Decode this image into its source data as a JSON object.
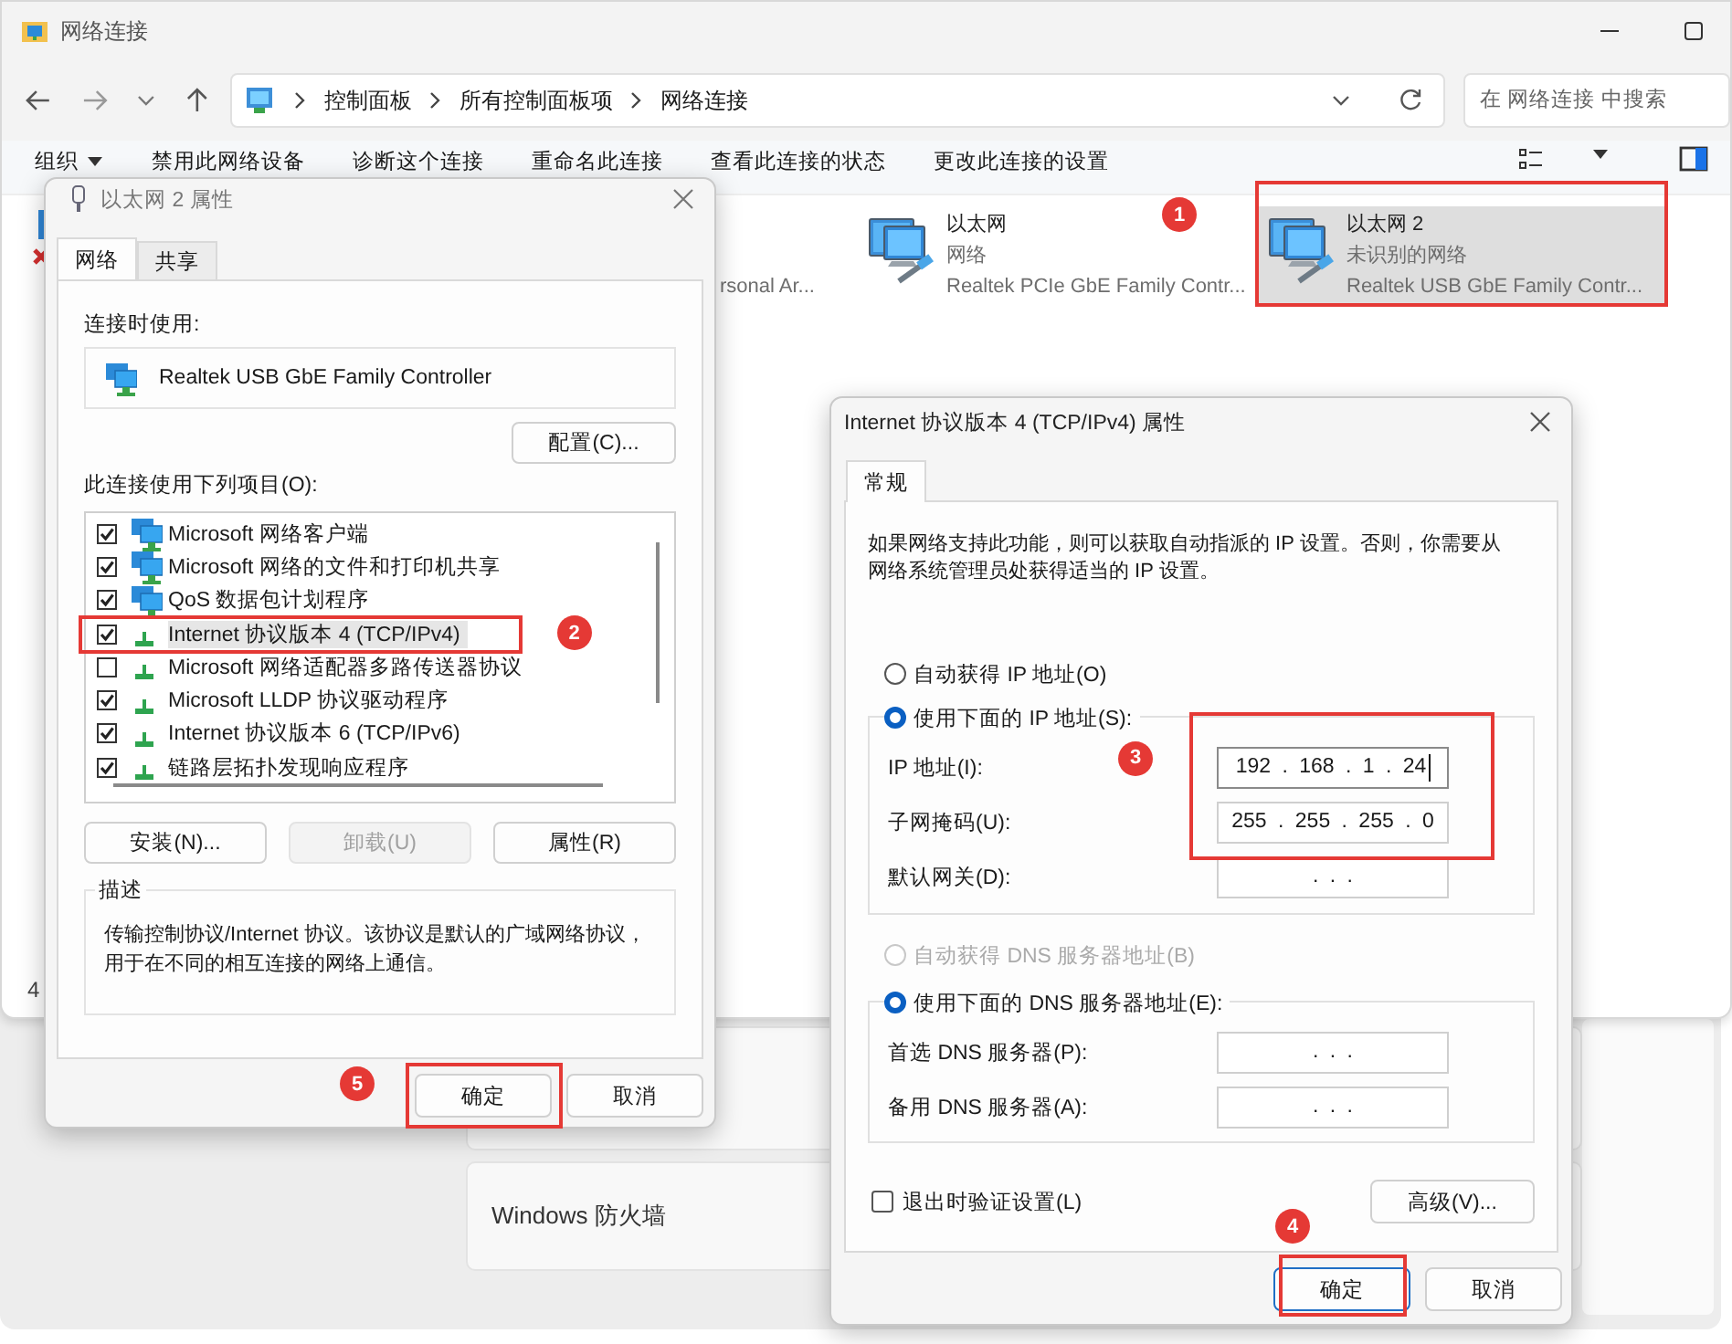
{
  "explorer": {
    "title": "网络连接",
    "breadcrumb": [
      "控制面板",
      "所有控制面板项",
      "网络连接"
    ],
    "search_placeholder": "在 网络连接 中搜索",
    "commands": [
      {
        "label": "组织",
        "menu": true
      },
      {
        "label": "禁用此网络设备",
        "menu": false
      },
      {
        "label": "诊断这个连接",
        "menu": false
      },
      {
        "label": "重命名此连接",
        "menu": false
      },
      {
        "label": "查看此连接的状态",
        "menu": false
      },
      {
        "label": "更改此连接的设置",
        "menu": false
      }
    ],
    "cut_item_text": "rsonal Ar...",
    "connections": [
      {
        "name": "以太网",
        "status": "网络",
        "adapter": "Realtek PCIe GbE Family Contr...",
        "selected": false
      },
      {
        "name": "以太网 2",
        "status": "未识别的网络",
        "adapter": "Realtek USB GbE Family Contr...",
        "selected": true,
        "step": "1"
      }
    ],
    "item_count": "4"
  },
  "settings": {
    "cards": [
      {
        "kind": "blank"
      },
      {
        "kind": "text",
        "label": "Windows 防火墙"
      }
    ]
  },
  "adapter_dialog": {
    "title": "以太网 2 属性",
    "tabs": [
      {
        "label": "网络",
        "selected": true
      },
      {
        "label": "共享",
        "selected": false
      }
    ],
    "connect_using_label": "连接时使用:",
    "adapter": "Realtek USB GbE Family Controller",
    "configure_button": "配置(C)...",
    "items_label": "此连接使用下列项目(O):",
    "items": [
      {
        "label": "Microsoft 网络客户端",
        "kind": "client",
        "checked": true,
        "selected": false
      },
      {
        "label": "Microsoft 网络的文件和打印机共享",
        "kind": "client",
        "checked": true,
        "selected": false
      },
      {
        "label": "QoS 数据包计划程序",
        "kind": "client",
        "checked": true,
        "selected": false
      },
      {
        "label": "Internet 协议版本 4 (TCP/IPv4)",
        "kind": "protocol",
        "checked": true,
        "selected": true,
        "step": "2"
      },
      {
        "label": "Microsoft 网络适配器多路传送器协议",
        "kind": "protocol",
        "checked": false,
        "selected": false
      },
      {
        "label": "Microsoft LLDP 协议驱动程序",
        "kind": "protocol",
        "checked": true,
        "selected": false
      },
      {
        "label": "Internet 协议版本 6 (TCP/IPv6)",
        "kind": "protocol",
        "checked": true,
        "selected": false
      },
      {
        "label": "链路层拓扑发现响应程序",
        "kind": "protocol",
        "checked": true,
        "selected": false
      }
    ],
    "buttons": [
      {
        "label": "安装(N)...",
        "disabled": false
      },
      {
        "label": "卸载(U)",
        "disabled": true
      },
      {
        "label": "属性(R)",
        "disabled": false
      }
    ],
    "description_label": "描述",
    "description": "传输控制协议/Internet 协议。该协议是默认的广域网络协议，用于在不同的相互连接的网络上通信。",
    "ok": {
      "label": "确定",
      "step": "5"
    },
    "cancel": {
      "label": "取消"
    }
  },
  "ipv4_dialog": {
    "title": "Internet 协议版本 4 (TCP/IPv4) 属性",
    "tabs": [
      {
        "label": "常规",
        "selected": true
      }
    ],
    "intro": "如果网络支持此功能，则可以获取自动指派的 IP 设置。否则，你需要从网络系统管理员处获得适当的 IP 设置。",
    "ip_auto": {
      "label": "自动获得 IP 地址(O)",
      "selected": false,
      "disabled": false
    },
    "ip_manual": {
      "label": "使用下面的 IP 地址(S):",
      "selected": true,
      "disabled": false
    },
    "ip_fields": [
      {
        "label": "IP 地址(I):",
        "value": "192 . 168 . 1 . 24",
        "focused": true
      },
      {
        "label": "子网掩码(U):",
        "value": "255 . 255 . 255 . 0",
        "focused": false
      },
      {
        "label": "默认网关(D):",
        "value": ". . .",
        "focused": false
      }
    ],
    "ip_step": "3",
    "dns_auto": {
      "label": "自动获得 DNS 服务器地址(B)",
      "selected": false,
      "disabled": true
    },
    "dns_manual": {
      "label": "使用下面的 DNS 服务器地址(E):",
      "selected": true,
      "disabled": false
    },
    "dns_fields": [
      {
        "label": "首选 DNS 服务器(P):",
        "value": ". . .",
        "focused": false
      },
      {
        "label": "备用 DNS 服务器(A):",
        "value": ". . .",
        "focused": false
      }
    ],
    "validate": {
      "label": "退出时验证设置(L)",
      "checked": false
    },
    "advanced": "高级(V)...",
    "ok": {
      "label": "确定",
      "step": "4"
    },
    "cancel": {
      "label": "取消"
    }
  }
}
